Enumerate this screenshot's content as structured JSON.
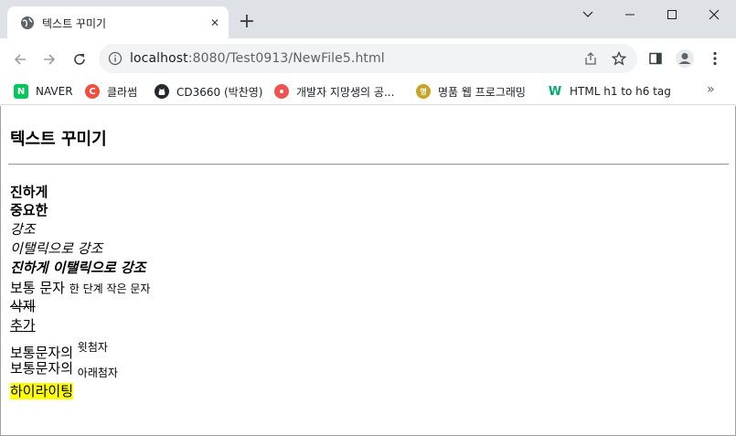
{
  "browser": {
    "tab_title": "텍스트 꾸미기",
    "tab_close": "✕",
    "new_tab": "+",
    "url_host": "localhost",
    "url_rest": ":8080/Test0913/NewFile5.html"
  },
  "bookmarks": [
    {
      "label": "NAVER",
      "icon": "naver-icon",
      "color": "#03c75a",
      "glyph": "N"
    },
    {
      "label": "클라썸",
      "icon": "classum-icon",
      "color": "#f04e3e",
      "glyph": "C"
    },
    {
      "label": "CD3660 (박찬영)",
      "icon": "github-icon",
      "color": "#24292f",
      "glyph": ""
    },
    {
      "label": "개발자 지망생의 공...",
      "icon": "blog-icon",
      "color": "#ef5350",
      "glyph": ""
    },
    {
      "label": "명품 웹 프로그래밍",
      "icon": "book-icon",
      "color": "#c9a227",
      "glyph": "명"
    },
    {
      "label": "HTML h1 to h6 tag",
      "icon": "w3schools-icon",
      "color": "#04aa6d",
      "glyph": "W"
    }
  ],
  "bookmarks_more": "»",
  "content": {
    "heading": "텍스트 꾸미기",
    "bold": "진하게",
    "strong": "중요한",
    "em": "강조",
    "italic_em": "이탤릭으로 강조",
    "bold_italic": "진하게 이탤릭으로 강조",
    "normal": "보통 문자",
    "small": "한 단계 작은 문자",
    "deleted": "삭제",
    "inserted": "추가",
    "sup_base": "보통문자의",
    "sup_text": "윗첨자",
    "sub_base": "보통문자의",
    "sub_text": "아래첨자",
    "highlight": "하이라이팅"
  },
  "colors": {
    "highlight": "#ffff00",
    "tabstrip": "#dee1e6",
    "omnibox": "#f1f3f4"
  }
}
